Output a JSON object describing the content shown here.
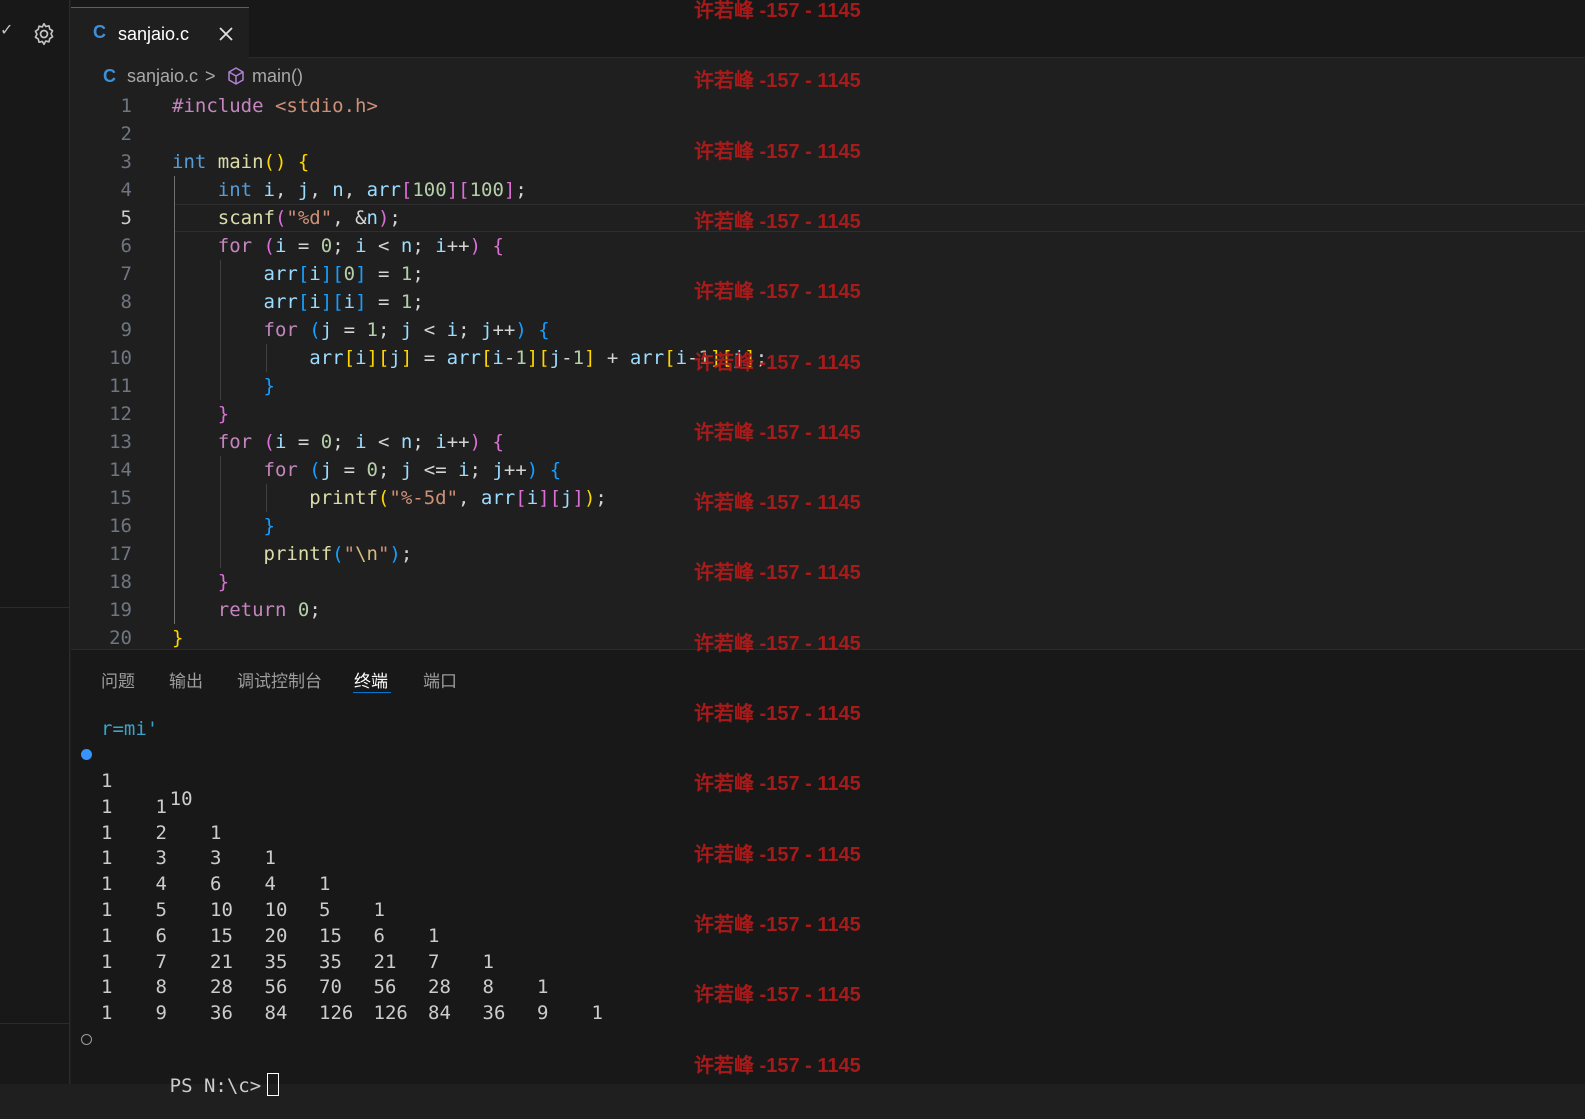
{
  "tab": {
    "icon": "C",
    "label": "sanjaio.c"
  },
  "breadcrumb": {
    "icon": "C",
    "file": "sanjaio.c",
    "separator": ">",
    "symbol": "main()"
  },
  "editor": {
    "line_numbers": [
      "1",
      "2",
      "3",
      "4",
      "5",
      "6",
      "7",
      "8",
      "9",
      "10",
      "11",
      "12",
      "13",
      "14",
      "15",
      "16",
      "17",
      "18",
      "19",
      "20"
    ],
    "current_line": 5
  },
  "panel": {
    "tabs": [
      "问题",
      "输出",
      "调试控制台",
      "终端",
      "端口"
    ],
    "active_tab": "终端"
  },
  "terminal": {
    "lines": [
      "r=mi'",
      "10"
    ],
    "rows": [
      [
        "1"
      ],
      [
        "1",
        "1"
      ],
      [
        "1",
        "2",
        "1"
      ],
      [
        "1",
        "3",
        "3",
        "1"
      ],
      [
        "1",
        "4",
        "6",
        "4",
        "1"
      ],
      [
        "1",
        "5",
        "10",
        "10",
        "5",
        "1"
      ],
      [
        "1",
        "6",
        "15",
        "20",
        "15",
        "6",
        "1"
      ],
      [
        "1",
        "7",
        "21",
        "35",
        "35",
        "21",
        "7",
        "1"
      ],
      [
        "1",
        "8",
        "28",
        "56",
        "70",
        "56",
        "28",
        "8",
        "1"
      ],
      [
        "1",
        "9",
        "36",
        "84",
        "126",
        "126",
        "84",
        "36",
        "9",
        "1"
      ]
    ],
    "prompt": "PS N:\\c>"
  },
  "watermark": "许若峰 -157 - 1145",
  "colors": {
    "accent": "#0078d4",
    "watermark": "#b31b1b",
    "editor_bg": "#1f1f1f",
    "panel_bg": "#181818"
  }
}
